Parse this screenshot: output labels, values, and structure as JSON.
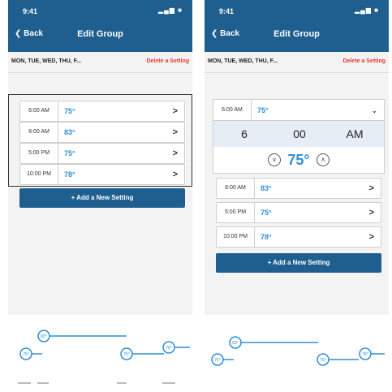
{
  "status": {
    "time": "9:41",
    "icons": "▂▄▆ ■"
  },
  "nav": {
    "back_label": "Back",
    "title": "Edit Group"
  },
  "days": {
    "label": "MON, TUE, WED, THU, F...",
    "delete_label": "Delete a Setting"
  },
  "left": {
    "settings": [
      {
        "time": "6:00 AM",
        "temp": "75°"
      },
      {
        "time": "8:00 AM",
        "temp": "83°"
      },
      {
        "time": "5:00 PM",
        "temp": "75°"
      },
      {
        "time": "10:00 PM",
        "temp": "78°"
      }
    ],
    "add_label": "+ Add a New Setting"
  },
  "right": {
    "expanded": {
      "time": "6:00 AM",
      "temp": "75°",
      "picker_hour": "6",
      "picker_minute": "00",
      "picker_ampm": "AM",
      "setpoint": "75°"
    },
    "settings": [
      {
        "time": "8:00 AM",
        "temp": "83°"
      },
      {
        "time": "5:00 PM",
        "temp": "75°"
      },
      {
        "time": "10:00 PM",
        "temp": "78°"
      }
    ],
    "add_label": "+ Add a New Setting"
  },
  "graph": {
    "bubbles": [
      "75°",
      "83°",
      "75°",
      "78°"
    ],
    "line_color": "#2f8fd6"
  },
  "colors": {
    "header": "#1e5f8f",
    "accent": "#2f8fd6",
    "delete": "#e33b2e"
  }
}
